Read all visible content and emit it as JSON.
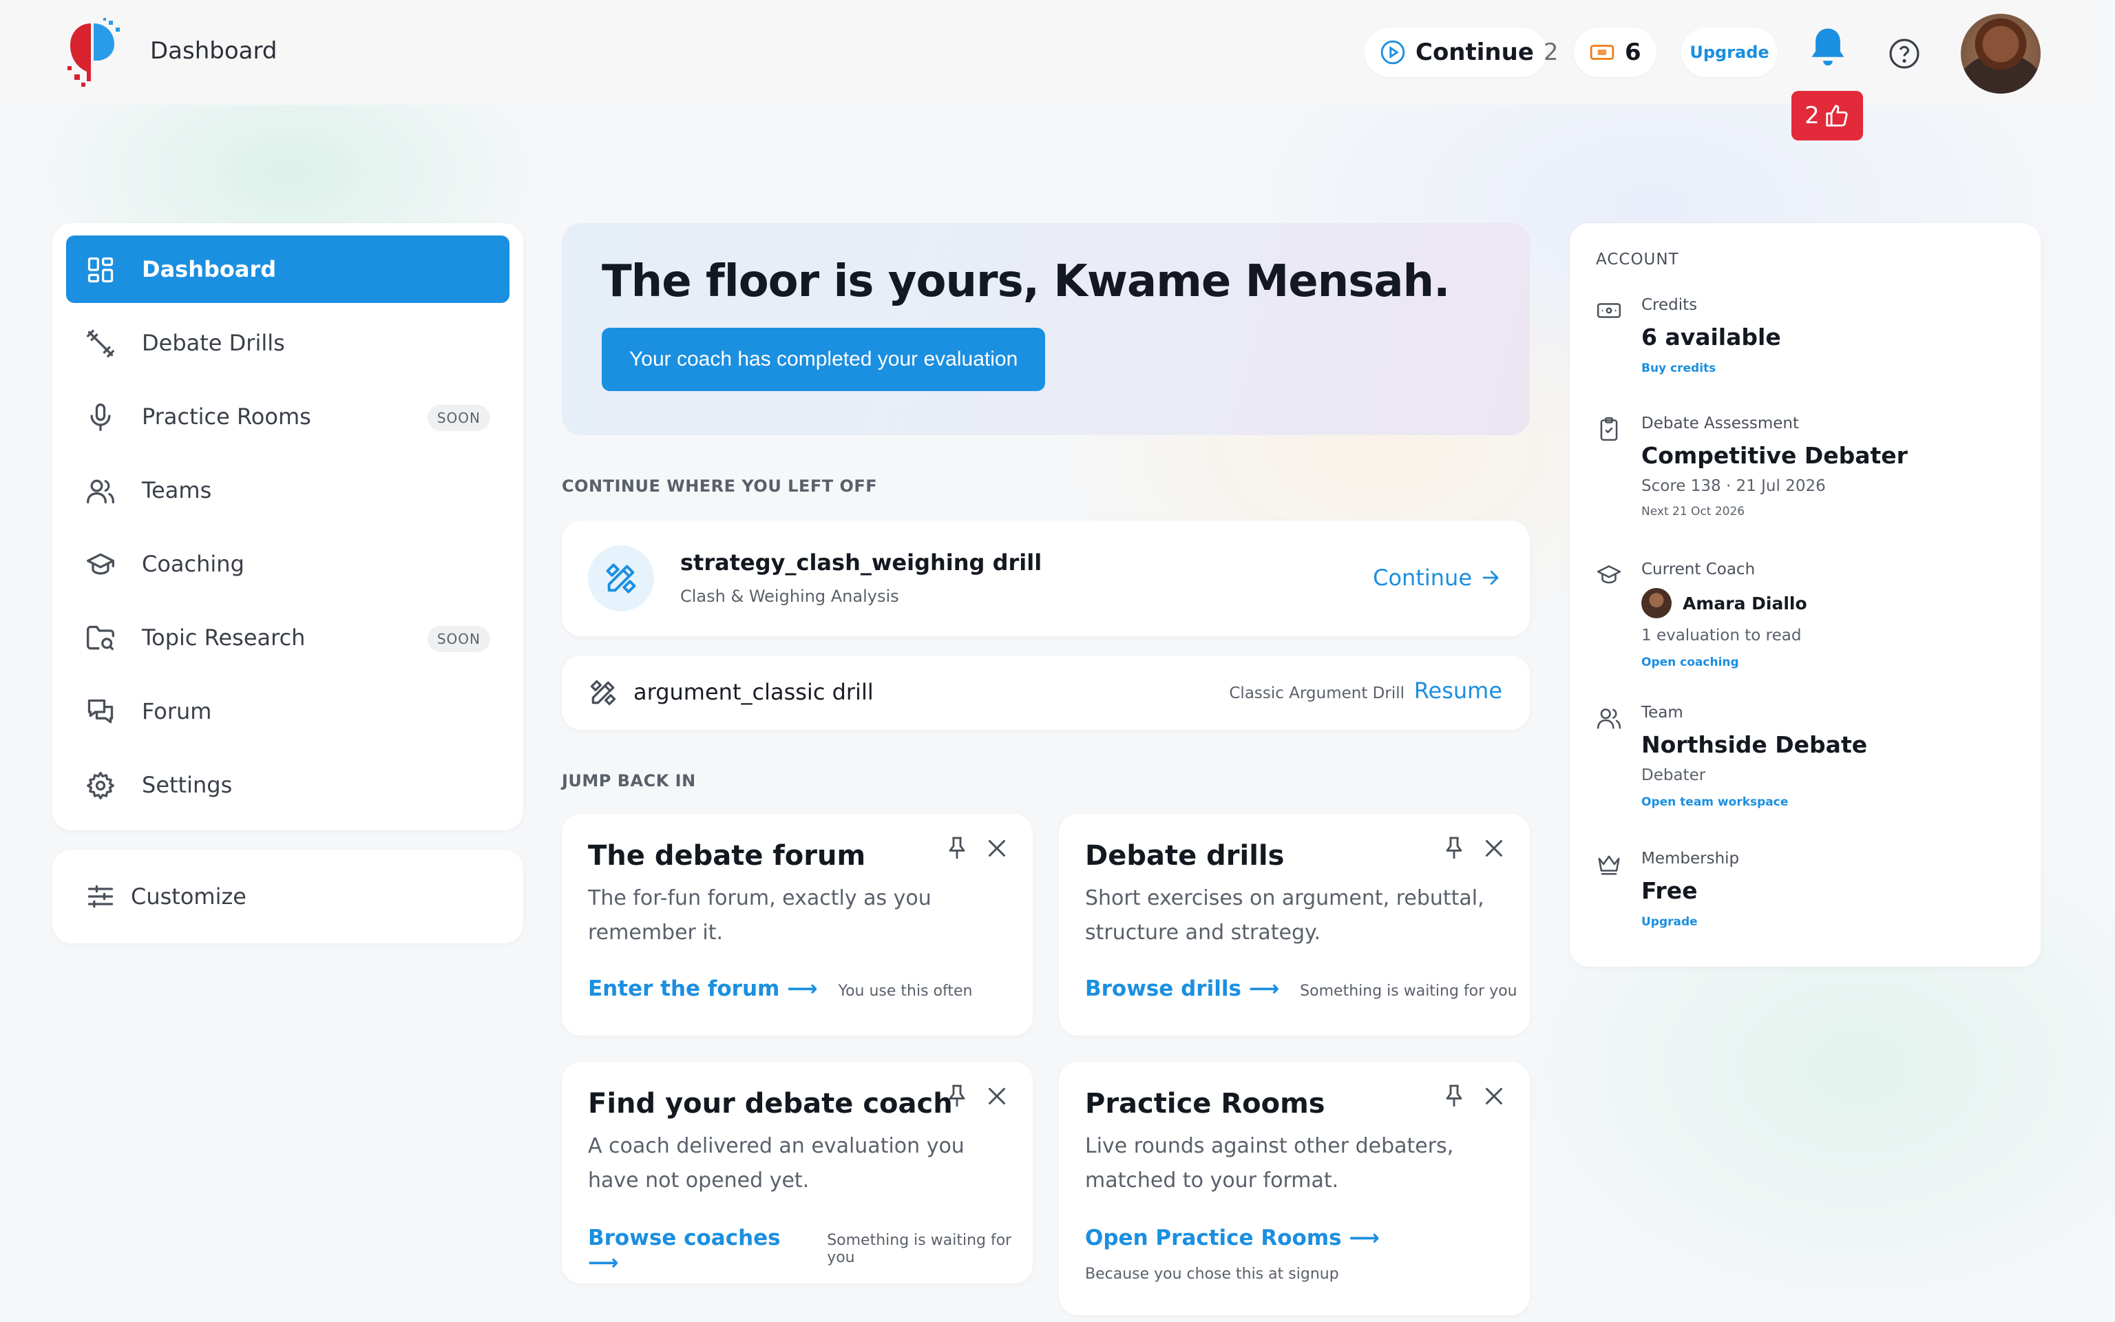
{
  "header": {
    "app_title": "Dashboard",
    "continue_label": "Continue",
    "continue_count": "2",
    "credits_count": "6",
    "upgrade_label": "Upgrade",
    "likes_count": "2"
  },
  "sidebar": {
    "items": [
      {
        "label": "Dashboard",
        "icon": "dashboard-grid-icon",
        "active": true
      },
      {
        "label": "Debate Drills",
        "icon": "dumbbell-icon"
      },
      {
        "label": "Practice Rooms",
        "icon": "microphone-icon",
        "badge": "SOON"
      },
      {
        "label": "Teams",
        "icon": "users-icon"
      },
      {
        "label": "Coaching",
        "icon": "graduation-cap-icon"
      },
      {
        "label": "Topic Research",
        "icon": "folder-search-icon",
        "badge": "SOON"
      },
      {
        "label": "Forum",
        "icon": "chat-bubbles-icon"
      },
      {
        "label": "Settings",
        "icon": "gear-icon"
      }
    ],
    "customize_label": "Customize"
  },
  "hero": {
    "title": "The floor is yours, Kwame Mensah.",
    "button_label": "Your coach has completed your evaluation"
  },
  "continue_section": {
    "heading": "CONTINUE WHERE YOU LEFT OFF",
    "primary": {
      "title": "strategy_clash_weighing drill",
      "subtitle": "Clash & Weighing Analysis",
      "action": "Continue"
    },
    "secondary": {
      "title": "argument_classic drill",
      "tag": "Classic Argument Drill",
      "action": "Resume"
    }
  },
  "jump_section": {
    "heading": "JUMP BACK IN",
    "tiles": [
      {
        "title": "The debate forum",
        "desc": "The for-fun forum, exactly as you remember it.",
        "link": "Enter the forum ⟶",
        "note": "You use this often"
      },
      {
        "title": "Debate drills",
        "desc": "Short exercises on argument, rebuttal, structure and strategy.",
        "link": "Browse drills ⟶",
        "note": "Something is waiting for you"
      },
      {
        "title": "Find your debate coach",
        "desc": "A coach delivered an evaluation you have not opened yet.",
        "link": "Browse coaches ⟶",
        "note": "Something is waiting for you"
      },
      {
        "title": "Practice Rooms",
        "desc": "Live rounds against other debaters, matched to your format.",
        "link": "Open Practice Rooms ⟶",
        "note": "Because you chose this at signup"
      }
    ]
  },
  "account": {
    "heading": "ACCOUNT",
    "credits": {
      "label": "Credits",
      "value": "6 available",
      "link": "Buy credits"
    },
    "assessment": {
      "label": "Debate Assessment",
      "value": "Competitive Debater",
      "meta": "Score 138 · 21 Jul 2026",
      "small": "Next 21 Oct 2026"
    },
    "coach": {
      "label": "Current Coach",
      "name": "Amara Diallo",
      "meta": "1 evaluation to read",
      "link": "Open coaching"
    },
    "team": {
      "label": "Team",
      "value": "Northside Debate",
      "meta": "Debater",
      "link": "Open team workspace"
    },
    "membership": {
      "label": "Membership",
      "value": "Free",
      "link": "Upgrade"
    }
  },
  "colors": {
    "accent": "#1b8fe0",
    "badge_red": "#e22a3a"
  }
}
